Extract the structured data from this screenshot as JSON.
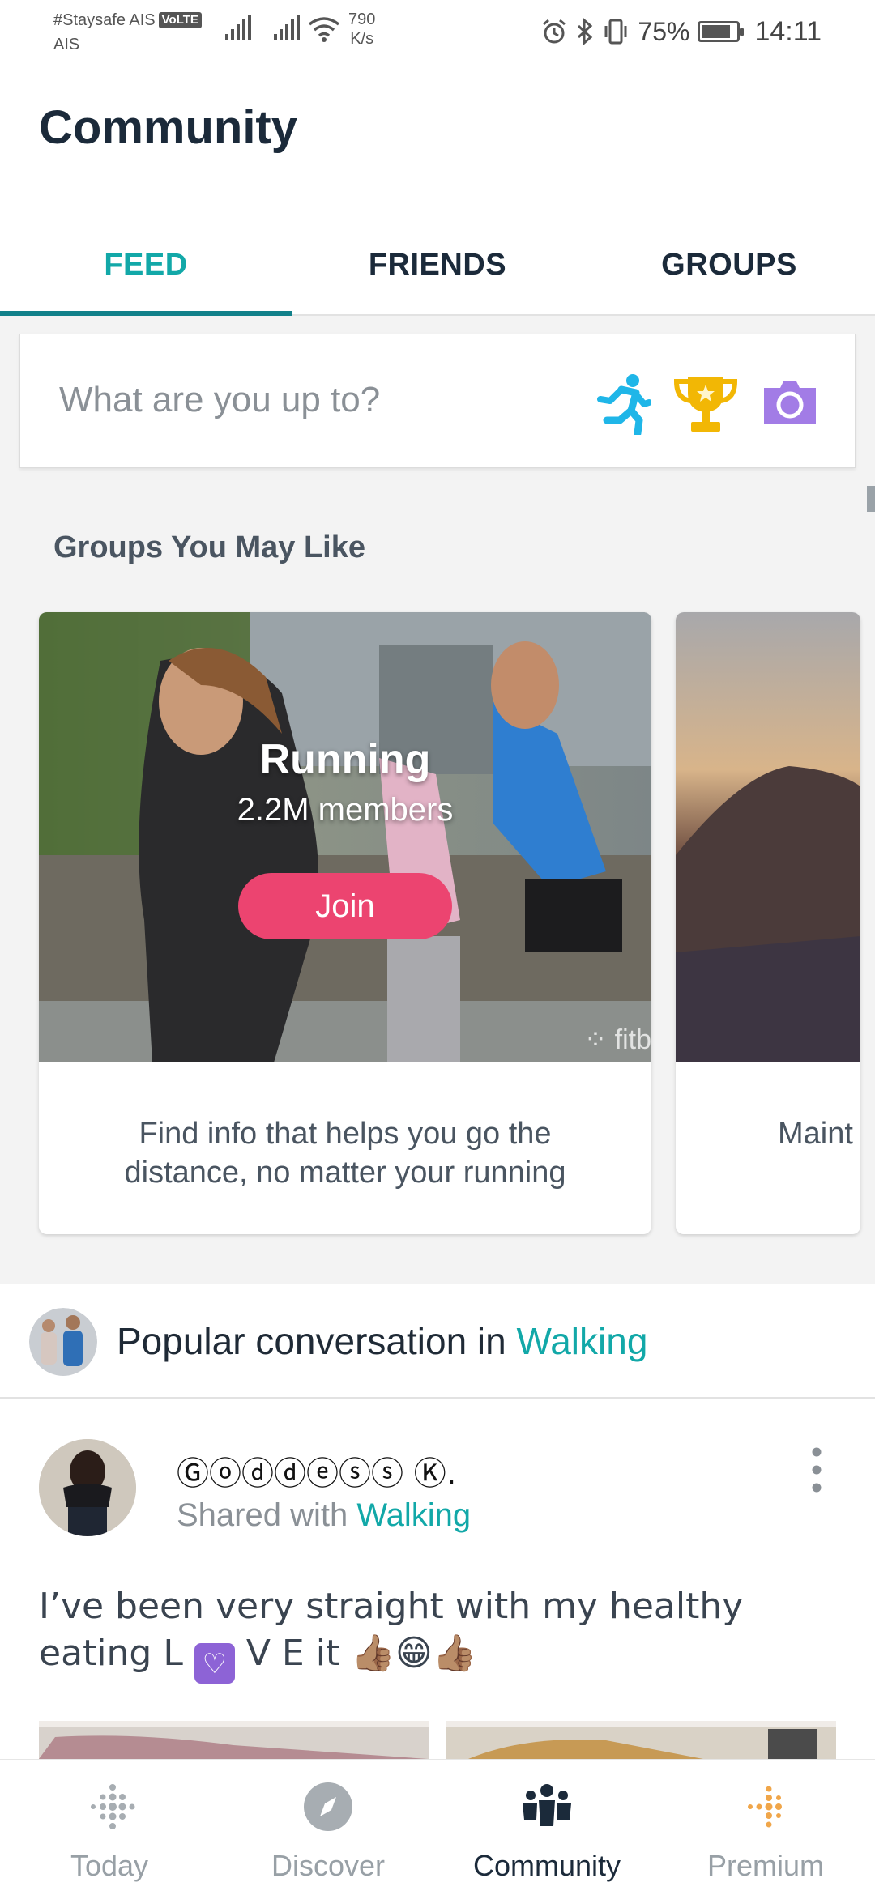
{
  "status_bar": {
    "carrier_line1": "#Staysafe AIS",
    "volte_badge": "VoLTE",
    "carrier_line2": "AIS",
    "speed_value": "790",
    "speed_unit": "K/s",
    "battery_percent": "75%",
    "battery_level": 0.75,
    "time": "14:11"
  },
  "header": {
    "title": "Community",
    "tabs": [
      {
        "label": "FEED",
        "active": true
      },
      {
        "label": "FRIENDS",
        "active": false
      },
      {
        "label": "GROUPS",
        "active": false
      }
    ]
  },
  "composer": {
    "placeholder": "What are you up to?",
    "icons": [
      "runner-icon",
      "trophy-icon",
      "camera-icon"
    ]
  },
  "groups": {
    "heading": "Groups You May Like",
    "cards": [
      {
        "name": "Running",
        "members": "2.2M members",
        "join_label": "Join",
        "watermark": "fitb",
        "description": "Find info that helps you go the distance, no matter your running"
      },
      {
        "description": "Maint"
      }
    ]
  },
  "popular_conversation": {
    "prefix": "Popular conversation in ",
    "group": "Walking"
  },
  "post": {
    "author": "Ⓖⓞⓓⓓⓔⓢⓢ Ⓚ.",
    "shared_prefix": "Shared with ",
    "shared_group": "Walking",
    "text_before_heart": "I’ve been very straight with my healthy eating L",
    "text_after_heart": " V E  it 👍🏽😁👍🏽"
  },
  "bottom_nav": [
    {
      "label": "Today",
      "icon": "fitbit-dots-icon",
      "active": false
    },
    {
      "label": "Discover",
      "icon": "compass-icon",
      "active": false
    },
    {
      "label": "Community",
      "icon": "community-icon",
      "active": true
    },
    {
      "label": "Premium",
      "icon": "premium-dots-icon",
      "active": false
    }
  ],
  "colors": {
    "teal_accent": "#12a8a8",
    "tab_indicator": "#12818a",
    "join_pink": "#ec4470",
    "runner_cyan": "#1fb6e8",
    "trophy_gold": "#f2b705",
    "camera_purple": "#a27ce6"
  }
}
